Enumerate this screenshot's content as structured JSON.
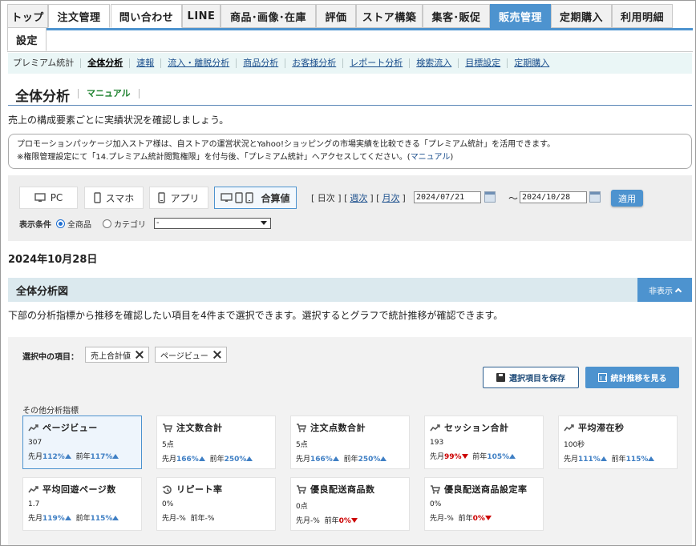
{
  "tabs": [
    {
      "label": "トップ",
      "state": "normal"
    },
    {
      "label": "注文管理",
      "state": "active"
    },
    {
      "label": "問い合わせ",
      "state": "active"
    },
    {
      "label": "LINE",
      "state": "normal"
    },
    {
      "label": "商品･画像･在庫",
      "state": "normal"
    },
    {
      "label": "評価",
      "state": "normal"
    },
    {
      "label": "ストア構築",
      "state": "normal"
    },
    {
      "label": "集客･販促",
      "state": "normal"
    },
    {
      "label": "販売管理",
      "state": "current"
    },
    {
      "label": "定期購入",
      "state": "normal"
    },
    {
      "label": "利用明細",
      "state": "normal"
    },
    {
      "label": "設定",
      "state": "active"
    }
  ],
  "subnav": [
    "プレミアム統計",
    "全体分析",
    "速報",
    "流入・離脱分析",
    "商品分析",
    "お客様分析",
    "レポート分析",
    "検索流入",
    "目標設定",
    "定期購入"
  ],
  "page": {
    "title": "全体分析",
    "manual": "マニュアル",
    "lead": "売上の構成要素ごとに実績状況を確認しましょう。",
    "notice_line1": "プロモーションパッケージ加入ストア様は、自ストアの運営状況とYahoo!ショッピングの市場実績を比較できる「プレミアム統計」を活用できます。",
    "notice_line2_pre": "※権限管理設定にて「14.プレミアム統計閲覧権限」を付与後、「プレミアム統計」へアクセスしてください。(",
    "notice_link": "マニュアル",
    "notice_line2_post": ")"
  },
  "filter": {
    "devices": [
      "PC",
      "スマホ",
      "アプリ",
      "合算値"
    ],
    "range_open": "[ 日次 ] [",
    "weekly": "週次",
    "range_mid": "] [",
    "monthly": "月次",
    "range_close": "]",
    "date_from": "2024/07/21",
    "date_to": "2024/10/28",
    "tilde": "～",
    "apply": "適用",
    "cond_label": "表示条件",
    "all_products": "全商品",
    "category": "カテゴリ",
    "category_value": "-"
  },
  "date_heading": "2024年10月28日",
  "section": {
    "title": "全体分析図",
    "hide": "非表示",
    "desc": "下部の分析指標から推移を確認したい項目を4件まで選択できます。選択するとグラフで統計推移が確認できます。"
  },
  "selection": {
    "label": "選択中の項目：",
    "chips": [
      "売上合計値",
      "ページビュー"
    ],
    "save": "選択項目を保存",
    "trend": "統計推移を見る",
    "other": "その他分析指標"
  },
  "metrics": [
    {
      "name": "ページビュー",
      "icon": "trend-icon",
      "value": "307",
      "mom_label": "先月",
      "mom": "112%",
      "mom_dir": "up",
      "yoy_label": "前年",
      "yoy": "117%",
      "yoy_dir": "up",
      "selected": true
    },
    {
      "name": "注文数合計",
      "icon": "cart-icon",
      "value": "5点",
      "mom_label": "先月",
      "mom": "166%",
      "mom_dir": "up",
      "yoy_label": "前年",
      "yoy": "250%",
      "yoy_dir": "up",
      "selected": false
    },
    {
      "name": "注文点数合計",
      "icon": "cart-icon",
      "value": "5点",
      "mom_label": "先月",
      "mom": "166%",
      "mom_dir": "up",
      "yoy_label": "前年",
      "yoy": "250%",
      "yoy_dir": "up",
      "selected": false
    },
    {
      "name": "セッション合計",
      "icon": "trend-icon",
      "value": "193",
      "mom_label": "先月",
      "mom": "99%",
      "mom_dir": "down",
      "yoy_label": "前年",
      "yoy": "105%",
      "yoy_dir": "up",
      "selected": false
    },
    {
      "name": "平均滞在秒",
      "icon": "trend-icon",
      "value": "100秒",
      "mom_label": "先月",
      "mom": "111%",
      "mom_dir": "up",
      "yoy_label": "前年",
      "yoy": "115%",
      "yoy_dir": "up",
      "selected": false
    },
    {
      "name": "平均回遊ページ数",
      "icon": "trend-icon",
      "value": "1.7",
      "mom_label": "先月",
      "mom": "119%",
      "mom_dir": "up",
      "yoy_label": "前年",
      "yoy": "115%",
      "yoy_dir": "up",
      "selected": false
    },
    {
      "name": "リピート率",
      "icon": "history-icon",
      "value": "0%",
      "mom_label": "先月",
      "mom": "-%",
      "mom_dir": "none",
      "yoy_label": "前年",
      "yoy": "-%",
      "yoy_dir": "none",
      "selected": false
    },
    {
      "name": "優良配送商品数",
      "icon": "cart-icon",
      "value": "0点",
      "mom_label": "先月",
      "mom": "-%",
      "mom_dir": "none",
      "yoy_label": "前年",
      "yoy": "0%",
      "yoy_dir": "down",
      "selected": false
    },
    {
      "name": "優良配送商品設定率",
      "icon": "cart-icon",
      "value": "0%",
      "mom_label": "先月",
      "mom": "-%",
      "mom_dir": "none",
      "yoy_label": "前年",
      "yoy": "0%",
      "yoy_dir": "down",
      "selected": false
    }
  ],
  "colors": {
    "accent": "#4d93cf",
    "up": "#3f7fc4",
    "down": "#cc0000",
    "subnav_bg": "#eaf6f6"
  }
}
